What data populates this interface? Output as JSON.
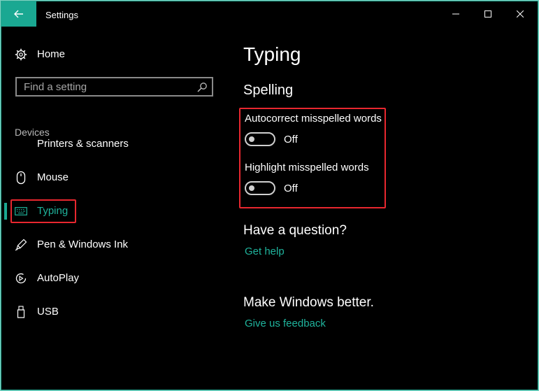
{
  "window": {
    "title": "Settings"
  },
  "sidebar": {
    "home_label": "Home",
    "search_placeholder": "Find a setting",
    "group_label": "Devices",
    "items": [
      {
        "label": "Printers & scanners",
        "icon": "printer-icon"
      },
      {
        "label": "Mouse",
        "icon": "mouse-icon"
      },
      {
        "label": "Typing",
        "icon": "keyboard-icon",
        "selected": true
      },
      {
        "label": "Pen & Windows Ink",
        "icon": "pen-icon"
      },
      {
        "label": "AutoPlay",
        "icon": "autoplay-icon"
      },
      {
        "label": "USB",
        "icon": "usb-icon"
      }
    ]
  },
  "main": {
    "title": "Typing",
    "section_title": "Spelling",
    "settings": [
      {
        "label": "Autocorrect misspelled words",
        "state": "Off"
      },
      {
        "label": "Highlight misspelled words",
        "state": "Off"
      }
    ],
    "question": {
      "title": "Have a question?",
      "link": "Get help"
    },
    "feedback": {
      "title": "Make Windows better.",
      "link": "Give us feedback"
    }
  },
  "colors": {
    "accent": "#1aa892",
    "highlight_box": "#e8272f",
    "background": "#000000"
  }
}
